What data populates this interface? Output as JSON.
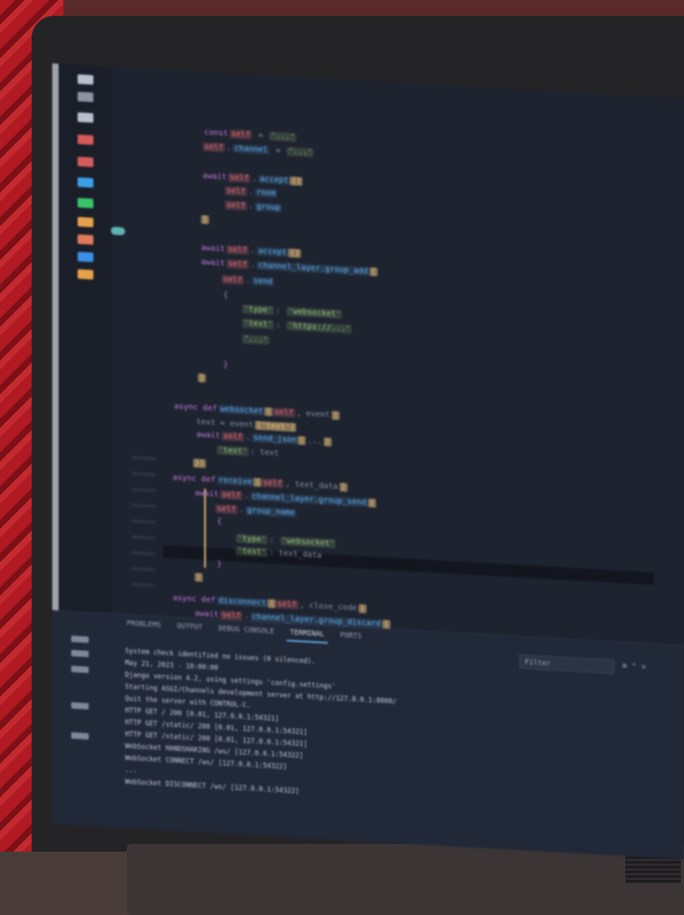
{
  "app": {
    "name": "code-editor",
    "theme_accent": "#61afef"
  },
  "activity_bar": {
    "icons": [
      {
        "name": "explorer-icon",
        "color": "#b9c0cc"
      },
      {
        "name": "search-icon",
        "color": "#8c93a1"
      },
      {
        "name": "source-control-icon",
        "color": "#b9c0cc"
      },
      {
        "name": "run-debug-icon",
        "color": "#d55a5a"
      },
      {
        "name": "extensions-icon",
        "color": "#d55a5a"
      },
      {
        "name": "remote-icon",
        "color": "#3aa0e8"
      },
      {
        "name": "testing-icon",
        "color": "#3ac46a"
      },
      {
        "name": "docker-icon",
        "color": "#e5a24b"
      },
      {
        "name": "database-icon",
        "color": "#e07a5a"
      },
      {
        "name": "live-share-icon",
        "color": "#3a8fe8"
      },
      {
        "name": "account-icon",
        "color": "#e5a24b"
      }
    ]
  },
  "editor": {
    "lines": [
      {
        "segments": [
          {
            "cls": "kw",
            "text": "const"
          },
          {
            "cls": "this",
            "text": "self"
          },
          {
            "cls": "plain",
            "text": " = "
          },
          {
            "cls": "str",
            "text": "'...'"
          }
        ]
      },
      {
        "segments": [
          {
            "cls": "this",
            "text": "self"
          },
          {
            "cls": "plain",
            "text": "."
          },
          {
            "cls": "ident",
            "text": "channel"
          },
          {
            "cls": "plain",
            "text": " = "
          },
          {
            "cls": "str",
            "text": "'...'"
          }
        ]
      },
      {
        "segments": [
          {
            "cls": "kw",
            "text": "await"
          },
          {
            "cls": "this",
            "text": "self"
          },
          {
            "cls": "plain",
            "text": "."
          },
          {
            "cls": "ident",
            "text": "accept"
          },
          {
            "cls": "brace",
            "text": "()"
          }
        ]
      },
      {
        "segments": [
          {
            "cls": "this",
            "text": "self"
          },
          {
            "cls": "plain",
            "text": "."
          },
          {
            "cls": "ident",
            "text": "room"
          }
        ]
      },
      {
        "segments": [
          {
            "cls": "this",
            "text": "self"
          },
          {
            "cls": "plain",
            "text": "."
          },
          {
            "cls": "ident",
            "text": "group"
          }
        ]
      },
      {
        "segments": [
          {
            "cls": "brace",
            "text": "}"
          }
        ]
      },
      {
        "segments": [
          {
            "cls": "kw",
            "text": "await"
          },
          {
            "cls": "this",
            "text": "self"
          },
          {
            "cls": "plain",
            "text": "."
          },
          {
            "cls": "ident",
            "text": "accept"
          },
          {
            "cls": "brace",
            "text": "()"
          }
        ]
      },
      {
        "segments": [
          {
            "cls": "kw",
            "text": "await"
          },
          {
            "cls": "this",
            "text": "self"
          },
          {
            "cls": "plain",
            "text": "."
          },
          {
            "cls": "ident",
            "text": "channel_layer.group_add"
          },
          {
            "cls": "brace",
            "text": "("
          }
        ]
      },
      {
        "segments": [
          {
            "cls": "this",
            "text": "self"
          },
          {
            "cls": "plain",
            "text": "."
          },
          {
            "cls": "ident",
            "text": "send"
          }
        ]
      },
      {
        "segments": [
          {
            "cls": "kw",
            "text": "{"
          }
        ]
      },
      {
        "segments": [
          {
            "cls": "str",
            "text": "'type'"
          },
          {
            "cls": "plain",
            "text": ": "
          },
          {
            "cls": "str",
            "text": "'websocket'"
          }
        ]
      },
      {
        "segments": [
          {
            "cls": "str",
            "text": "'text'"
          },
          {
            "cls": "plain",
            "text": ": "
          },
          {
            "cls": "str",
            "text": "'https://...'"
          }
        ]
      },
      {
        "segments": [
          {
            "cls": "str",
            "text": "'...'"
          }
        ]
      },
      {
        "segments": [
          {
            "cls": "kw",
            "text": "}"
          }
        ]
      },
      {
        "segments": [
          {
            "cls": "brace",
            "text": "}"
          }
        ]
      },
      {
        "segments": [
          {
            "cls": "kw",
            "text": "async def"
          },
          {
            "cls": "ident",
            "text": "websocket"
          },
          {
            "cls": "brace",
            "text": "("
          },
          {
            "cls": "this",
            "text": "self"
          },
          {
            "cls": "plain",
            "text": ", event"
          },
          {
            "cls": "brace",
            "text": ")"
          }
        ]
      },
      {
        "segments": [
          {
            "cls": "plain",
            "text": "text = event"
          },
          {
            "cls": "brace",
            "text": "['text']"
          }
        ]
      },
      {
        "segments": [
          {
            "cls": "kw",
            "text": "await"
          },
          {
            "cls": "this",
            "text": "self"
          },
          {
            "cls": "plain",
            "text": "."
          },
          {
            "cls": "ident",
            "text": "send_json"
          },
          {
            "cls": "brace",
            "text": "("
          },
          {
            "cls": "plain",
            "text": "..."
          },
          {
            "cls": "brace",
            "text": ")"
          }
        ]
      },
      {
        "segments": [
          {
            "cls": "str",
            "text": "'text'"
          },
          {
            "cls": "plain",
            "text": ": text"
          }
        ]
      },
      {
        "segments": [
          {
            "cls": "brace",
            "text": "})"
          }
        ]
      },
      {
        "segments": [
          {
            "cls": "kw",
            "text": "async def"
          },
          {
            "cls": "ident",
            "text": "receive"
          },
          {
            "cls": "brace",
            "text": "("
          },
          {
            "cls": "this",
            "text": "self"
          },
          {
            "cls": "plain",
            "text": ", text_data"
          },
          {
            "cls": "brace",
            "text": ")"
          }
        ]
      },
      {
        "segments": [
          {
            "cls": "kw",
            "text": "await"
          },
          {
            "cls": "this",
            "text": "self"
          },
          {
            "cls": "plain",
            "text": "."
          },
          {
            "cls": "ident",
            "text": "channel_layer.group_send"
          },
          {
            "cls": "brace",
            "text": "("
          }
        ]
      },
      {
        "segments": [
          {
            "cls": "this",
            "text": "self"
          },
          {
            "cls": "plain",
            "text": "."
          },
          {
            "cls": "ident",
            "text": "group_name"
          }
        ]
      },
      {
        "segments": [
          {
            "cls": "kw",
            "text": "{"
          }
        ]
      },
      {
        "segments": [
          {
            "cls": "str",
            "text": "'type'"
          },
          {
            "cls": "plain",
            "text": ": "
          },
          {
            "cls": "str",
            "text": "'websocket'"
          }
        ]
      },
      {
        "segments": [
          {
            "cls": "str",
            "text": "'text'"
          },
          {
            "cls": "plain",
            "text": ": text_data"
          }
        ]
      },
      {
        "segments": [
          {
            "cls": "kw",
            "text": "}"
          }
        ]
      },
      {
        "segments": [
          {
            "cls": "brace",
            "text": ")"
          }
        ]
      },
      {
        "segments": [
          {
            "cls": "kw",
            "text": "async def"
          },
          {
            "cls": "ident",
            "text": "disconnect"
          },
          {
            "cls": "brace",
            "text": "("
          },
          {
            "cls": "this",
            "text": "self"
          },
          {
            "cls": "plain",
            "text": ", close_code"
          },
          {
            "cls": "brace",
            "text": ")"
          }
        ]
      },
      {
        "segments": [
          {
            "cls": "kw",
            "text": "await"
          },
          {
            "cls": "this",
            "text": "self"
          },
          {
            "cls": "plain",
            "text": "."
          },
          {
            "cls": "ident",
            "text": "channel_layer.group_discard"
          },
          {
            "cls": "brace",
            "text": "("
          }
        ]
      }
    ]
  },
  "panel": {
    "tabs": [
      "PROBLEMS",
      "OUTPUT",
      "DEBUG CONSOLE",
      "TERMINAL",
      "PORTS"
    ],
    "active_tab": 3,
    "filter_placeholder": "Filter",
    "controls": "≡ ⌃ ✕",
    "terminal_lines": [
      "System check identified no issues (0 silenced).",
      "May 21, 2023 - 18:00:00",
      "Django version 4.2, using settings 'config.settings'",
      "Starting ASGI/Channels development server at http://127.0.0.1:8000/",
      "Quit the server with CONTROL-C.",
      "HTTP GET / 200 [0.01, 127.0.0.1:54321]",
      "HTTP GET /static/ 200 [0.01, 127.0.0.1:54321]",
      "HTTP GET /static/ 200 [0.01, 127.0.0.1:54321]",
      "WebSocket HANDSHAKING /ws/ [127.0.0.1:54322]",
      "WebSocket CONNECT /ws/ [127.0.0.1:54322]",
      "...",
      "WebSocket DISCONNECT /ws/ [127.0.0.1:54322]"
    ]
  }
}
